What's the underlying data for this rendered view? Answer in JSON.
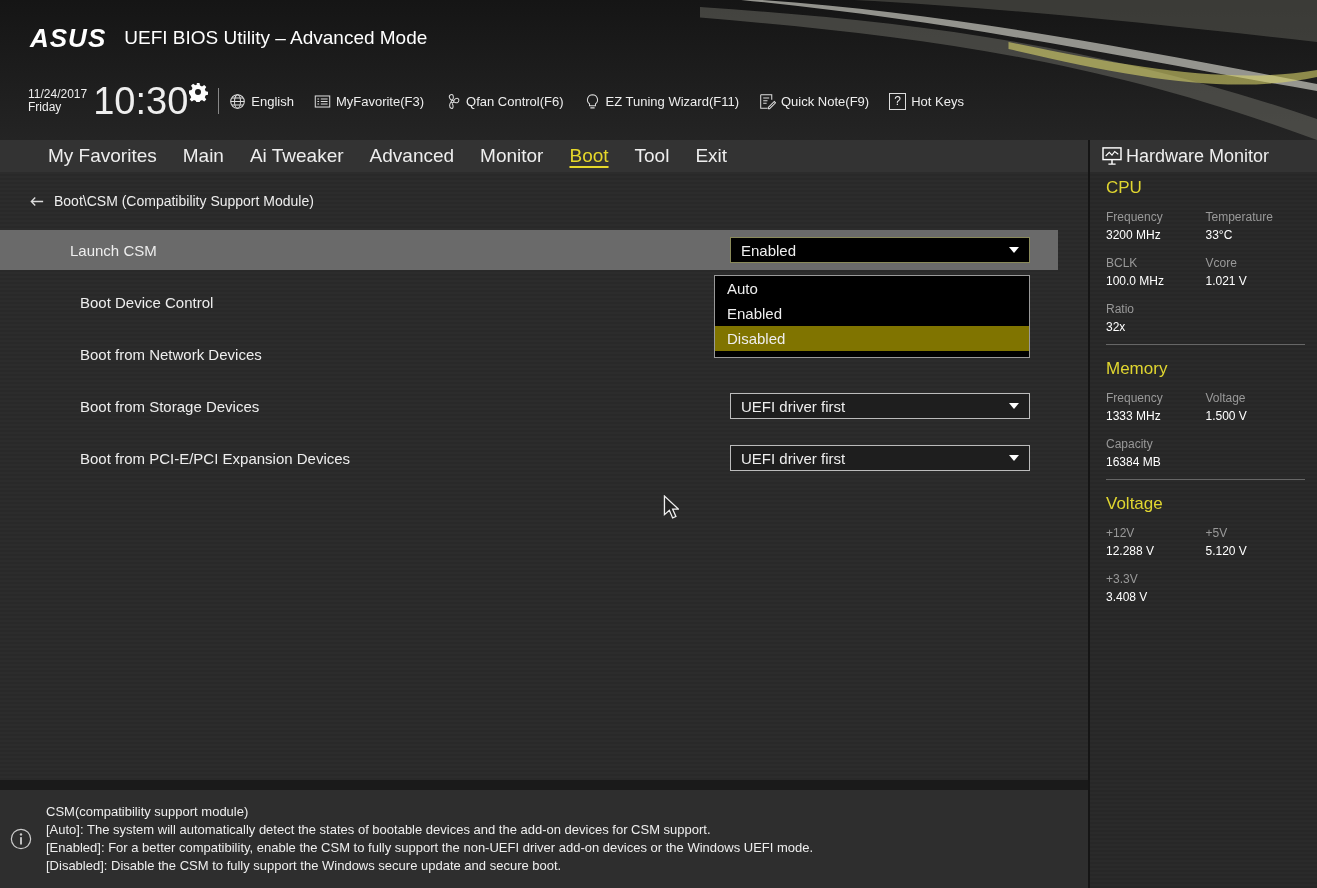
{
  "header": {
    "logo": "ASUS",
    "title": "UEFI BIOS Utility – Advanced Mode",
    "date": "11/24/2017",
    "day": "Friday",
    "time": "10:30",
    "toolbar": [
      {
        "label": "English"
      },
      {
        "label": "MyFavorite(F3)"
      },
      {
        "label": "Qfan Control(F6)"
      },
      {
        "label": "EZ Tuning Wizard(F11)"
      },
      {
        "label": "Quick Note(F9)"
      },
      {
        "label": "Hot Keys",
        "key_glyph": "?"
      }
    ]
  },
  "tabs": [
    {
      "label": "My Favorites",
      "selected": false
    },
    {
      "label": "Main",
      "selected": false
    },
    {
      "label": "Ai Tweaker",
      "selected": false
    },
    {
      "label": "Advanced",
      "selected": false
    },
    {
      "label": "Monitor",
      "selected": false
    },
    {
      "label": "Boot",
      "selected": true
    },
    {
      "label": "Tool",
      "selected": false
    },
    {
      "label": "Exit",
      "selected": false
    }
  ],
  "breadcrumb": "Boot\\CSM (Compatibility Support Module)",
  "settings": [
    {
      "label": "Launch CSM",
      "highlighted": true,
      "value": "Enabled"
    },
    {
      "label": "Boot Device Control",
      "highlighted": false
    },
    {
      "label": "Boot from Network Devices",
      "highlighted": false
    },
    {
      "label": "Boot from Storage Devices",
      "highlighted": false,
      "value": "UEFI driver first"
    },
    {
      "label": "Boot from PCI-E/PCI Expansion Devices",
      "highlighted": false,
      "value": "UEFI driver first"
    }
  ],
  "dropdown_menu": {
    "options": [
      {
        "label": "Auto",
        "selected": false
      },
      {
        "label": "Enabled",
        "selected": false
      },
      {
        "label": "Disabled",
        "selected": true
      }
    ]
  },
  "help": {
    "title": "CSM(compatibility support module)",
    "lines": [
      "[Auto]: The system will automatically detect the states of bootable devices and the add-on devices for CSM support.",
      "[Enabled]: For a better compatibility, enable the CSM to fully support the non-UEFI driver add-on devices or the Windows UEFI mode.",
      "[Disabled]: Disable the CSM to fully support the Windows secure update and secure boot."
    ]
  },
  "hardware_monitor": {
    "title": "Hardware Monitor",
    "sections": [
      {
        "title": "CPU",
        "items": [
          {
            "label": "Frequency",
            "value": "3200 MHz"
          },
          {
            "label": "Temperature",
            "value": "33°C"
          },
          {
            "label": "BCLK",
            "value": "100.0 MHz"
          },
          {
            "label": "Vcore",
            "value": "1.021 V"
          },
          {
            "label": "Ratio",
            "value": "32x"
          }
        ]
      },
      {
        "title": "Memory",
        "items": [
          {
            "label": "Frequency",
            "value": "1333 MHz"
          },
          {
            "label": "Voltage",
            "value": "1.500 V"
          },
          {
            "label": "Capacity",
            "value": "16384 MB"
          }
        ]
      },
      {
        "title": "Voltage",
        "items": [
          {
            "label": "+12V",
            "value": "12.288 V"
          },
          {
            "label": "+5V",
            "value": "5.120 V"
          },
          {
            "label": "+3.3V",
            "value": "3.408 V"
          }
        ]
      }
    ]
  }
}
